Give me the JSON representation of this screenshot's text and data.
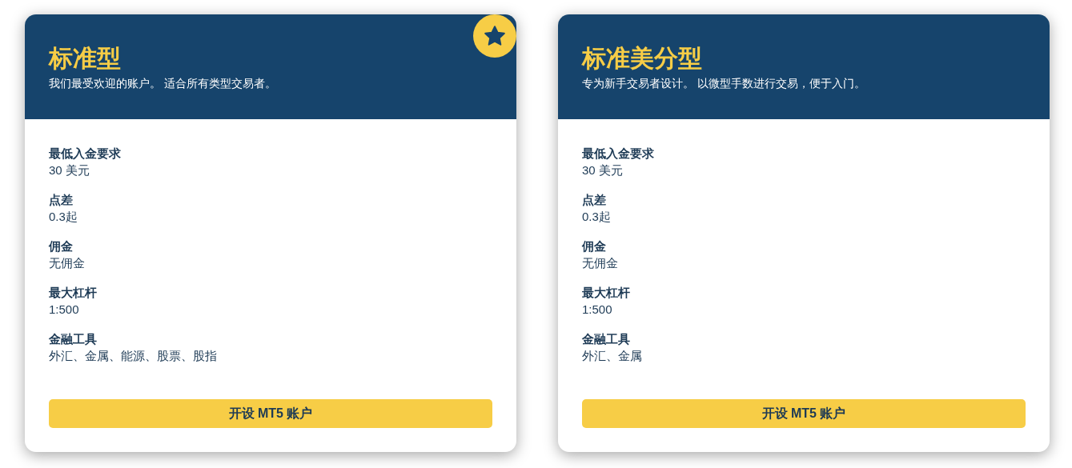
{
  "cards": [
    {
      "title": "标准型",
      "subtitle": "我们最受欢迎的账户。 适合所有类型交易者。",
      "featured": true,
      "specs": [
        {
          "label": "最低入金要求",
          "value": "30 美元"
        },
        {
          "label": "点差",
          "value": "0.3起"
        },
        {
          "label": "佣金",
          "value": "无佣金"
        },
        {
          "label": "最大杠杆",
          "value": "1:500"
        },
        {
          "label": "金融工具",
          "value": "外汇、金属、能源、股票、股指"
        }
      ],
      "button": "开设 MT5 账户"
    },
    {
      "title": "标准美分型",
      "subtitle": "专为新手交易者设计。 以微型手数进行交易，便于入门。",
      "featured": false,
      "specs": [
        {
          "label": "最低入金要求",
          "value": "30 美元"
        },
        {
          "label": "点差",
          "value": "0.3起"
        },
        {
          "label": "佣金",
          "value": "无佣金"
        },
        {
          "label": "最大杠杆",
          "value": "1:500"
        },
        {
          "label": "金融工具",
          "value": "外汇、金属"
        }
      ],
      "button": "开设 MT5 账户"
    }
  ]
}
